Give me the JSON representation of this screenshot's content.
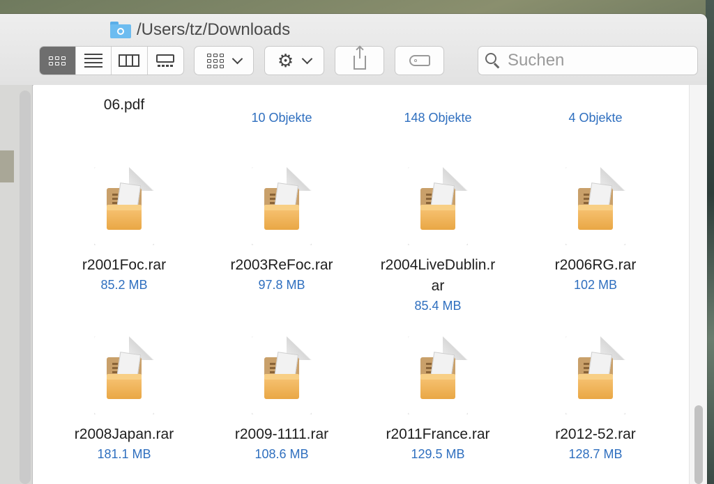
{
  "window": {
    "path": "/Users/tz/Downloads"
  },
  "toolbar": {
    "view_modes": [
      "icon-view",
      "list-view",
      "column-view",
      "gallery-view"
    ],
    "active_view": "icon-view",
    "search_placeholder": "Suchen"
  },
  "partial_row": [
    {
      "name_line": "06.pdf",
      "meta": ""
    },
    {
      "name_line": "",
      "meta": "10 Objekte"
    },
    {
      "name_line": "",
      "meta": "148 Objekte"
    },
    {
      "name_line": "",
      "meta": "4 Objekte"
    }
  ],
  "files": [
    {
      "name": "r2001Foc.rar",
      "size": "85.2 MB"
    },
    {
      "name": "r2003ReFoc.rar",
      "size": "97.8 MB"
    },
    {
      "name": "r2004LiveDublin.r\nar",
      "size": "85.4 MB"
    },
    {
      "name": "r2006RG.rar",
      "size": "102 MB"
    },
    {
      "name": "r2008Japan.rar",
      "size": "181.1 MB"
    },
    {
      "name": "r2009-1111.rar",
      "size": "108.6 MB"
    },
    {
      "name": "r2011France.rar",
      "size": "129.5 MB"
    },
    {
      "name": "r2012-52.rar",
      "size": "128.7 MB"
    }
  ],
  "colors": {
    "meta_text": "#2f6fbf",
    "archive_box": "#e9a745"
  }
}
